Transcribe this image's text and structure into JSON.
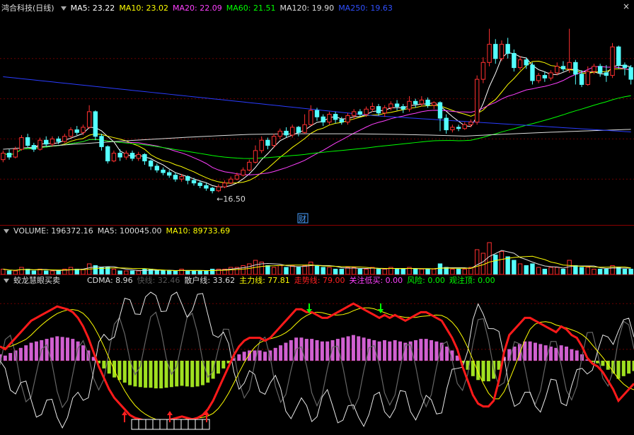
{
  "main": {
    "title": "鸿合科技(日线)",
    "ma_labels": [
      {
        "text": "MA5: 23.22",
        "color": "#ffffff"
      },
      {
        "text": "MA10: 23.02",
        "color": "#ffff00"
      },
      {
        "text": "MA20: 22.09",
        "color": "#ff40ff"
      },
      {
        "text": "MA60: 21.51",
        "color": "#00ff00"
      },
      {
        "text": "MA120: 19.90",
        "color": "#dddddd"
      },
      {
        "text": "MA250: 19.63",
        "color": "#3050ff"
      }
    ],
    "low_label": "16.50",
    "fin_label": "财"
  },
  "volume": {
    "labels": [
      {
        "text": "VOLUME: 196372.16",
        "color": "#dddddd"
      },
      {
        "text": "MA5: 100045.00",
        "color": "#dddddd"
      },
      {
        "text": "MA10: 89733.69",
        "color": "#ffff00"
      }
    ]
  },
  "indicator": {
    "name": "蛟龙慧眼买卖",
    "labels": [
      {
        "text": "CDMA: 8.96",
        "color": "#dddddd"
      },
      {
        "text": "快线: 32.46",
        "color": "#555555"
      },
      {
        "text": "散户线: 33.62",
        "color": "#dddddd"
      },
      {
        "text": "主力线: 77.81",
        "color": "#ffff00"
      },
      {
        "text": "走势线: 79.00",
        "color": "#ff2020"
      },
      {
        "text": "关注低买: 0.00",
        "color": "#ff40ff"
      },
      {
        "text": "风险: 0.00",
        "color": "#00ff00"
      },
      {
        "text": "观注顶: 0.00",
        "color": "#00ff00"
      }
    ]
  },
  "chart_data": {
    "type": "candlestick",
    "price_ylim": [
      14.5,
      30
    ],
    "candles": [
      [
        19.1,
        19.6,
        19.8,
        18.9
      ],
      [
        19.6,
        19.3,
        19.9,
        19.1
      ],
      [
        19.3,
        19.9,
        20.1,
        19.2
      ],
      [
        19.9,
        20.8,
        21.0,
        19.8
      ],
      [
        20.8,
        20.2,
        21.1,
        20.0
      ],
      [
        20.2,
        19.9,
        20.4,
        19.7
      ],
      [
        19.9,
        20.6,
        20.8,
        19.8
      ],
      [
        20.6,
        20.3,
        20.9,
        20.1
      ],
      [
        20.3,
        20.7,
        20.9,
        20.1
      ],
      [
        20.7,
        20.5,
        20.9,
        20.3
      ],
      [
        20.5,
        20.9,
        21.1,
        20.4
      ],
      [
        20.9,
        21.4,
        21.6,
        20.8
      ],
      [
        21.4,
        21.2,
        21.7,
        21.0
      ],
      [
        21.2,
        21.6,
        21.8,
        21.0
      ],
      [
        21.6,
        22.8,
        23.3,
        21.5
      ],
      [
        22.8,
        20.9,
        22.9,
        20.6
      ],
      [
        20.9,
        20.1,
        21.1,
        19.8
      ],
      [
        20.1,
        19.0,
        20.2,
        18.8
      ],
      [
        19.0,
        19.6,
        19.8,
        18.9
      ],
      [
        19.6,
        19.3,
        19.9,
        19.0
      ],
      [
        19.3,
        19.6,
        19.8,
        19.1
      ],
      [
        19.6,
        19.2,
        19.8,
        19.0
      ],
      [
        19.2,
        19.5,
        19.7,
        19.0
      ],
      [
        19.5,
        19.0,
        19.6,
        18.7
      ],
      [
        19.0,
        18.6,
        19.1,
        18.3
      ],
      [
        18.6,
        18.3,
        18.8,
        18.1
      ],
      [
        18.3,
        18.1,
        18.5,
        17.9
      ],
      [
        18.1,
        17.9,
        18.3,
        17.7
      ],
      [
        17.9,
        17.6,
        18.1,
        17.4
      ],
      [
        17.6,
        17.8,
        18.0,
        17.4
      ],
      [
        17.8,
        17.5,
        17.9,
        17.2
      ],
      [
        17.5,
        17.3,
        17.7,
        17.1
      ],
      [
        17.3,
        17.1,
        17.5,
        16.9
      ],
      [
        17.1,
        16.9,
        17.3,
        16.7
      ],
      [
        16.9,
        16.7,
        17.0,
        16.5
      ],
      [
        16.7,
        17.0,
        17.2,
        16.6
      ],
      [
        17.0,
        17.3,
        17.5,
        16.9
      ],
      [
        17.3,
        17.6,
        17.8,
        17.2
      ],
      [
        17.6,
        17.9,
        18.1,
        17.5
      ],
      [
        17.9,
        18.3,
        18.5,
        17.8
      ],
      [
        18.3,
        18.9,
        19.1,
        18.2
      ],
      [
        18.9,
        19.8,
        20.2,
        18.8
      ],
      [
        19.8,
        20.6,
        20.9,
        19.6
      ],
      [
        20.6,
        20.2,
        20.8,
        19.9
      ],
      [
        20.2,
        20.9,
        21.1,
        20.0
      ],
      [
        20.9,
        21.3,
        21.5,
        20.7
      ],
      [
        21.3,
        21.0,
        21.6,
        20.8
      ],
      [
        21.0,
        21.6,
        21.8,
        20.8
      ],
      [
        21.6,
        21.2,
        21.7,
        20.9
      ],
      [
        21.2,
        21.8,
        22.6,
        21.1
      ],
      [
        21.8,
        22.9,
        23.3,
        21.7
      ],
      [
        22.9,
        22.4,
        23.1,
        22.1
      ],
      [
        22.4,
        22.0,
        22.6,
        21.7
      ],
      [
        22.0,
        22.6,
        22.8,
        21.8
      ],
      [
        22.6,
        22.2,
        22.8,
        21.9
      ],
      [
        22.2,
        22.0,
        22.4,
        21.8
      ],
      [
        22.0,
        22.5,
        22.7,
        21.8
      ],
      [
        22.5,
        22.8,
        23.0,
        22.2
      ],
      [
        22.8,
        22.6,
        23.0,
        22.4
      ],
      [
        22.6,
        23.0,
        23.2,
        22.4
      ],
      [
        23.0,
        23.2,
        23.5,
        22.8
      ],
      [
        23.2,
        22.7,
        23.4,
        22.5
      ],
      [
        22.7,
        23.1,
        23.3,
        22.4
      ],
      [
        23.1,
        23.4,
        23.6,
        22.9
      ],
      [
        23.4,
        23.2,
        23.7,
        22.9
      ],
      [
        23.2,
        23.0,
        23.4,
        22.7
      ],
      [
        23.0,
        23.6,
        24.0,
        22.8
      ],
      [
        23.6,
        23.4,
        23.8,
        23.1
      ],
      [
        23.4,
        23.7,
        24.0,
        23.2
      ],
      [
        23.7,
        23.3,
        23.9,
        23.1
      ],
      [
        23.3,
        23.5,
        23.6,
        23.0
      ],
      [
        23.5,
        22.3,
        23.6,
        21.3
      ],
      [
        22.3,
        21.4,
        22.6,
        21.1
      ],
      [
        21.4,
        21.6,
        21.8,
        21.2
      ],
      [
        21.6,
        21.5,
        21.8,
        21.3
      ],
      [
        21.5,
        21.8,
        22.0,
        21.4
      ],
      [
        21.8,
        22.0,
        22.2,
        21.6
      ],
      [
        22.0,
        25.3,
        25.6,
        21.8
      ],
      [
        25.3,
        26.6,
        27.0,
        25.0
      ],
      [
        26.6,
        28.0,
        29.2,
        26.3
      ],
      [
        28.0,
        26.9,
        28.4,
        26.5
      ],
      [
        26.9,
        28.0,
        28.3,
        26.7
      ],
      [
        28.0,
        27.3,
        28.5,
        26.9
      ],
      [
        27.3,
        26.2,
        27.6,
        25.9
      ],
      [
        26.2,
        26.8,
        27.1,
        26.0
      ],
      [
        26.8,
        26.4,
        27.0,
        26.1
      ],
      [
        26.4,
        25.2,
        26.6,
        24.9
      ],
      [
        25.2,
        25.6,
        25.8,
        25.0
      ],
      [
        25.6,
        25.4,
        25.9,
        25.1
      ],
      [
        25.4,
        25.8,
        26.0,
        25.2
      ],
      [
        25.8,
        26.3,
        26.6,
        25.6
      ],
      [
        26.3,
        26.1,
        26.7,
        25.9
      ],
      [
        26.1,
        26.6,
        29.2,
        25.8
      ],
      [
        26.6,
        25.7,
        26.8,
        24.9
      ],
      [
        25.7,
        24.9,
        26.0,
        24.7
      ],
      [
        24.9,
        25.9,
        26.3,
        24.8
      ],
      [
        25.9,
        26.3,
        26.5,
        25.7
      ],
      [
        26.3,
        25.8,
        26.5,
        25.5
      ],
      [
        25.8,
        25.6,
        26.4,
        25.1
      ],
      [
        25.6,
        27.8,
        28.1,
        25.4
      ],
      [
        27.8,
        26.4,
        27.9,
        26.1
      ],
      [
        26.4,
        26.2,
        26.6,
        25.6
      ],
      [
        26.2,
        25.3,
        26.4,
        24.9
      ]
    ],
    "volume_ylim": [
      0,
      20
    ],
    "volume": [
      3,
      2,
      2,
      4,
      3,
      2,
      3,
      2,
      2,
      2,
      3,
      4,
      3,
      3,
      6,
      5,
      4,
      4,
      3,
      2,
      2,
      2,
      2,
      3,
      3,
      2,
      2,
      2,
      2,
      3,
      2,
      2,
      2,
      2,
      3,
      3,
      3,
      4,
      4,
      5,
      6,
      8,
      7,
      5,
      4,
      5,
      4,
      5,
      4,
      5,
      7,
      5,
      4,
      4,
      3,
      3,
      4,
      4,
      3,
      3,
      4,
      3,
      3,
      4,
      3,
      3,
      4,
      3,
      3,
      3,
      3,
      6,
      4,
      3,
      3,
      3,
      4,
      14,
      12,
      18,
      11,
      13,
      10,
      8,
      6,
      5,
      6,
      4,
      3,
      4,
      4,
      3,
      8,
      5,
      4,
      4,
      3,
      3,
      3,
      5,
      4,
      3,
      3
    ],
    "indicator_ylim": [
      0,
      100
    ],
    "trend_line": [
      60,
      58,
      62,
      66,
      70,
      74,
      78,
      80,
      82,
      84,
      86,
      88,
      87,
      86,
      84,
      80,
      74,
      66,
      56,
      46,
      38,
      30,
      24,
      20,
      16,
      12,
      10,
      9,
      8,
      8,
      7,
      7,
      8,
      9,
      10,
      11,
      10,
      9,
      10,
      12,
      16,
      22,
      30,
      38,
      46,
      54,
      60,
      64,
      66,
      66,
      66,
      64,
      66,
      70,
      74,
      78,
      82,
      86,
      86,
      84,
      84,
      82,
      80,
      80,
      82,
      84,
      86,
      88,
      90,
      88,
      86,
      84,
      82,
      80,
      82,
      80,
      82,
      80,
      78,
      80,
      82,
      84,
      84,
      82,
      80,
      78,
      72,
      66,
      58,
      46,
      36,
      26,
      20,
      18,
      18,
      22,
      36,
      56,
      68,
      72,
      76,
      80,
      80,
      78,
      76,
      74,
      72,
      70,
      74,
      72,
      68,
      66,
      60,
      52,
      48,
      46,
      42,
      36,
      30,
      22,
      26,
      30,
      34
    ]
  }
}
